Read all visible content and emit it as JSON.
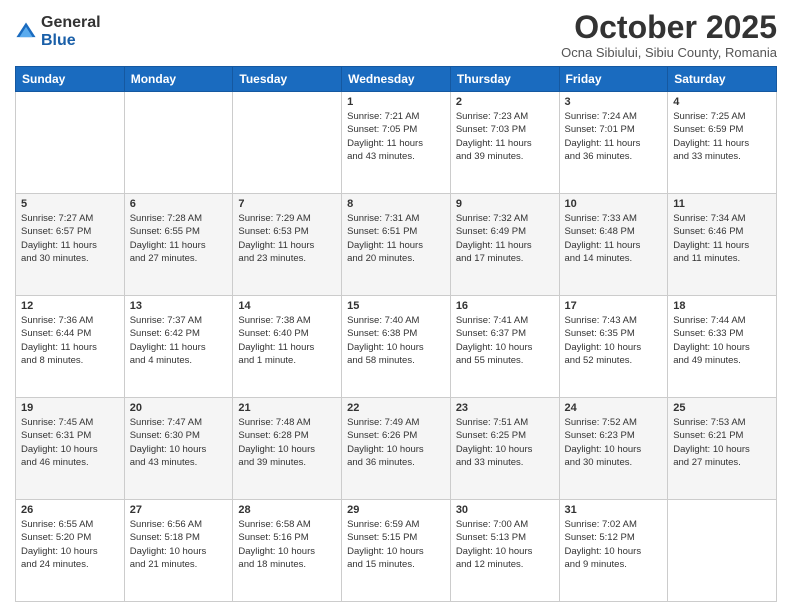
{
  "logo": {
    "general": "General",
    "blue": "Blue"
  },
  "header": {
    "title": "October 2025",
    "location": "Ocna Sibiului, Sibiu County, Romania"
  },
  "days_of_week": [
    "Sunday",
    "Monday",
    "Tuesday",
    "Wednesday",
    "Thursday",
    "Friday",
    "Saturday"
  ],
  "weeks": [
    [
      {
        "day": "",
        "info": ""
      },
      {
        "day": "",
        "info": ""
      },
      {
        "day": "",
        "info": ""
      },
      {
        "day": "1",
        "info": "Sunrise: 7:21 AM\nSunset: 7:05 PM\nDaylight: 11 hours\nand 43 minutes."
      },
      {
        "day": "2",
        "info": "Sunrise: 7:23 AM\nSunset: 7:03 PM\nDaylight: 11 hours\nand 39 minutes."
      },
      {
        "day": "3",
        "info": "Sunrise: 7:24 AM\nSunset: 7:01 PM\nDaylight: 11 hours\nand 36 minutes."
      },
      {
        "day": "4",
        "info": "Sunrise: 7:25 AM\nSunset: 6:59 PM\nDaylight: 11 hours\nand 33 minutes."
      }
    ],
    [
      {
        "day": "5",
        "info": "Sunrise: 7:27 AM\nSunset: 6:57 PM\nDaylight: 11 hours\nand 30 minutes."
      },
      {
        "day": "6",
        "info": "Sunrise: 7:28 AM\nSunset: 6:55 PM\nDaylight: 11 hours\nand 27 minutes."
      },
      {
        "day": "7",
        "info": "Sunrise: 7:29 AM\nSunset: 6:53 PM\nDaylight: 11 hours\nand 23 minutes."
      },
      {
        "day": "8",
        "info": "Sunrise: 7:31 AM\nSunset: 6:51 PM\nDaylight: 11 hours\nand 20 minutes."
      },
      {
        "day": "9",
        "info": "Sunrise: 7:32 AM\nSunset: 6:49 PM\nDaylight: 11 hours\nand 17 minutes."
      },
      {
        "day": "10",
        "info": "Sunrise: 7:33 AM\nSunset: 6:48 PM\nDaylight: 11 hours\nand 14 minutes."
      },
      {
        "day": "11",
        "info": "Sunrise: 7:34 AM\nSunset: 6:46 PM\nDaylight: 11 hours\nand 11 minutes."
      }
    ],
    [
      {
        "day": "12",
        "info": "Sunrise: 7:36 AM\nSunset: 6:44 PM\nDaylight: 11 hours\nand 8 minutes."
      },
      {
        "day": "13",
        "info": "Sunrise: 7:37 AM\nSunset: 6:42 PM\nDaylight: 11 hours\nand 4 minutes."
      },
      {
        "day": "14",
        "info": "Sunrise: 7:38 AM\nSunset: 6:40 PM\nDaylight: 11 hours\nand 1 minute."
      },
      {
        "day": "15",
        "info": "Sunrise: 7:40 AM\nSunset: 6:38 PM\nDaylight: 10 hours\nand 58 minutes."
      },
      {
        "day": "16",
        "info": "Sunrise: 7:41 AM\nSunset: 6:37 PM\nDaylight: 10 hours\nand 55 minutes."
      },
      {
        "day": "17",
        "info": "Sunrise: 7:43 AM\nSunset: 6:35 PM\nDaylight: 10 hours\nand 52 minutes."
      },
      {
        "day": "18",
        "info": "Sunrise: 7:44 AM\nSunset: 6:33 PM\nDaylight: 10 hours\nand 49 minutes."
      }
    ],
    [
      {
        "day": "19",
        "info": "Sunrise: 7:45 AM\nSunset: 6:31 PM\nDaylight: 10 hours\nand 46 minutes."
      },
      {
        "day": "20",
        "info": "Sunrise: 7:47 AM\nSunset: 6:30 PM\nDaylight: 10 hours\nand 43 minutes."
      },
      {
        "day": "21",
        "info": "Sunrise: 7:48 AM\nSunset: 6:28 PM\nDaylight: 10 hours\nand 39 minutes."
      },
      {
        "day": "22",
        "info": "Sunrise: 7:49 AM\nSunset: 6:26 PM\nDaylight: 10 hours\nand 36 minutes."
      },
      {
        "day": "23",
        "info": "Sunrise: 7:51 AM\nSunset: 6:25 PM\nDaylight: 10 hours\nand 33 minutes."
      },
      {
        "day": "24",
        "info": "Sunrise: 7:52 AM\nSunset: 6:23 PM\nDaylight: 10 hours\nand 30 minutes."
      },
      {
        "day": "25",
        "info": "Sunrise: 7:53 AM\nSunset: 6:21 PM\nDaylight: 10 hours\nand 27 minutes."
      }
    ],
    [
      {
        "day": "26",
        "info": "Sunrise: 6:55 AM\nSunset: 5:20 PM\nDaylight: 10 hours\nand 24 minutes."
      },
      {
        "day": "27",
        "info": "Sunrise: 6:56 AM\nSunset: 5:18 PM\nDaylight: 10 hours\nand 21 minutes."
      },
      {
        "day": "28",
        "info": "Sunrise: 6:58 AM\nSunset: 5:16 PM\nDaylight: 10 hours\nand 18 minutes."
      },
      {
        "day": "29",
        "info": "Sunrise: 6:59 AM\nSunset: 5:15 PM\nDaylight: 10 hours\nand 15 minutes."
      },
      {
        "day": "30",
        "info": "Sunrise: 7:00 AM\nSunset: 5:13 PM\nDaylight: 10 hours\nand 12 minutes."
      },
      {
        "day": "31",
        "info": "Sunrise: 7:02 AM\nSunset: 5:12 PM\nDaylight: 10 hours\nand 9 minutes."
      },
      {
        "day": "",
        "info": ""
      }
    ]
  ]
}
